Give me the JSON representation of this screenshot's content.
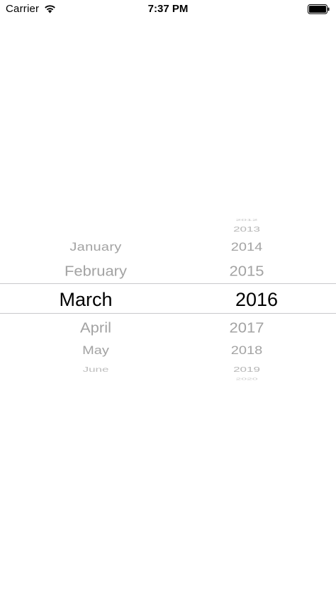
{
  "status_bar": {
    "carrier": "Carrier",
    "time": "7:37 PM"
  },
  "picker": {
    "months": [
      "",
      "January",
      "February",
      "March",
      "April",
      "May",
      "June",
      ""
    ],
    "years": [
      "2012",
      "2013",
      "2014",
      "2015",
      "2016",
      "2017",
      "2018",
      "2019",
      "2020"
    ],
    "selected_month": "March",
    "selected_year": "2016",
    "colors": {
      "selected": "#000000",
      "faded": "#a3a3a3",
      "divider": "#c8c8cc"
    }
  }
}
